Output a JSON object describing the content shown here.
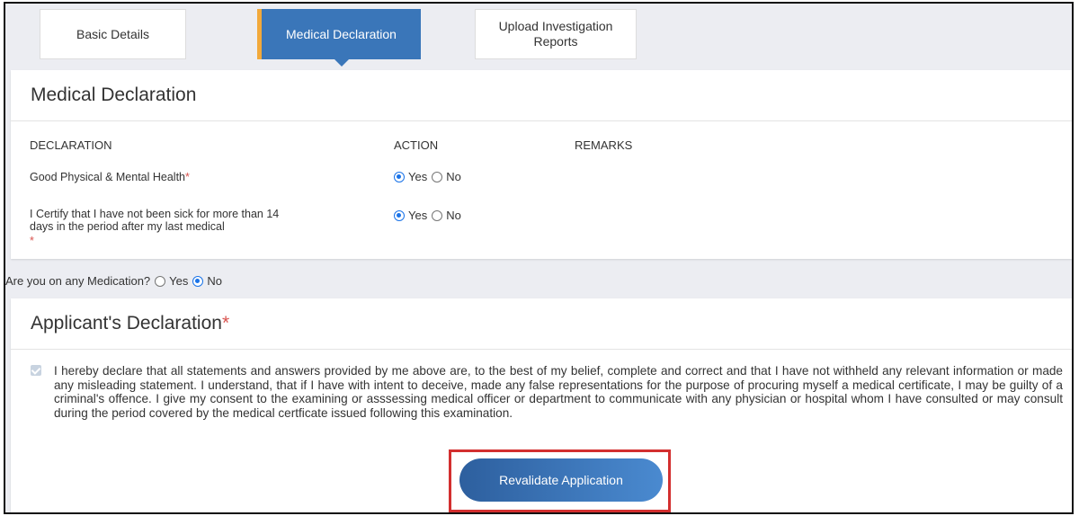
{
  "tabs": [
    {
      "label": "Basic Details"
    },
    {
      "label": "Medical Declaration"
    },
    {
      "label_line1": "Upload Investigation",
      "label_line2": "Reports"
    }
  ],
  "medical": {
    "title": "Medical Declaration",
    "columns": {
      "declaration": "DECLARATION",
      "action": "ACTION",
      "remarks": "REMARKS"
    },
    "rows": [
      {
        "label": "Good Physical & Mental Health",
        "required_mark": "*",
        "yes_label": "Yes",
        "no_label": "No",
        "selected": "Yes"
      },
      {
        "label_line1": "I Certify that I have not been sick for more than 14",
        "label_line2": "days in the period after my last medical",
        "required_mark": "*",
        "yes_label": "Yes",
        "no_label": "No",
        "selected": "Yes"
      }
    ]
  },
  "medication": {
    "question": "Are you on any Medication?",
    "yes_label": "Yes",
    "no_label": "No",
    "selected": "No"
  },
  "applicant": {
    "title": "Applicant's Declaration",
    "required_mark": "*",
    "checked": true,
    "text": "I hereby declare that all statements and answers provided by me above are, to the best of my belief, complete and correct and that I have not withheld any relevant information or made any misleading statement. I understand, that if I have with intent to deceive, made any false representations for the purpose of procuring myself a medical certificate, I may be guilty of a criminal's offence. I give my consent to the examining or asssessing medical officer or department to communicate with any physician or hospital whom I have consulted or may consult during the period covered by the medical certficate issued following this examination."
  },
  "actions": {
    "revalidate_label": "Revalidate Application"
  },
  "colors": {
    "tab_active": "#3a76b9",
    "tab_accent": "#f2a93b",
    "required": "#d9534f",
    "highlight": "#d32f2f"
  }
}
